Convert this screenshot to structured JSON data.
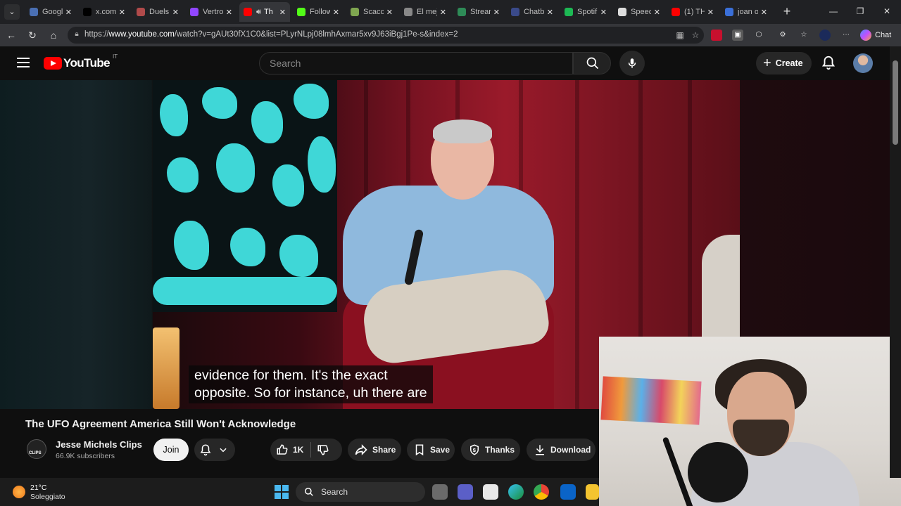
{
  "browser": {
    "tabs": [
      {
        "label": "Googl",
        "icon": "google-icon",
        "color": "#4a6fb3"
      },
      {
        "label": "x.com/",
        "icon": "x-icon",
        "color": "#000000"
      },
      {
        "label": "Duels",
        "icon": "map-pin-icon",
        "color": "#b04a4a"
      },
      {
        "label": "Vertro",
        "icon": "twitch-icon",
        "color": "#9146ff"
      },
      {
        "label": "Th",
        "icon": "youtube-icon",
        "color": "#ff0000"
      },
      {
        "label": "Follow",
        "icon": "kick-icon",
        "color": "#53fc18"
      },
      {
        "label": "Scacc",
        "icon": "chess-icon",
        "color": "#7fa650"
      },
      {
        "label": "El mej",
        "icon": "github-icon",
        "color": "#888888"
      },
      {
        "label": "Strean",
        "icon": "stream-icon",
        "color": "#2e8b57"
      },
      {
        "label": "Chatb",
        "icon": "bot-icon",
        "color": "#3a4a8a"
      },
      {
        "label": "Spotif",
        "icon": "spotify-icon",
        "color": "#1db954"
      },
      {
        "label": "Speed",
        "icon": "speedtest-icon",
        "color": "#dddddd"
      },
      {
        "label": "(1) TH",
        "icon": "youtube-icon",
        "color": "#ff0000"
      },
      {
        "label": "joan o",
        "icon": "search-icon",
        "color": "#3a6fd8"
      }
    ],
    "url_prefix": "https://",
    "url_host": "www.youtube.com",
    "url_path": "/watch?v=gAUt30fX1C0&list=PLyrNLpj08lmhAxmar5xv9J63iBgj1Pe-s&index=2",
    "chat_label": "Chat"
  },
  "youtube": {
    "logo_text": "YouTube",
    "country_code": "IT",
    "search_placeholder": "Search",
    "create_label": "Create"
  },
  "video": {
    "caption_line1": "evidence for them. It's the exact",
    "caption_line2": "opposite. So for instance, uh there are",
    "title": "The UFO Agreement America Still Won't Acknowledge"
  },
  "channel": {
    "name": "Jesse Michels Clips",
    "subscribers": "66.9K subscribers",
    "avatar_text": "CLIPS",
    "join_label": "Join"
  },
  "actions": {
    "like_count": "1K",
    "share_label": "Share",
    "save_label": "Save",
    "thanks_label": "Thanks",
    "download_label": "Download"
  },
  "taskbar": {
    "temperature": "21°C",
    "weather": "Soleggiato",
    "search_label": "Search"
  }
}
